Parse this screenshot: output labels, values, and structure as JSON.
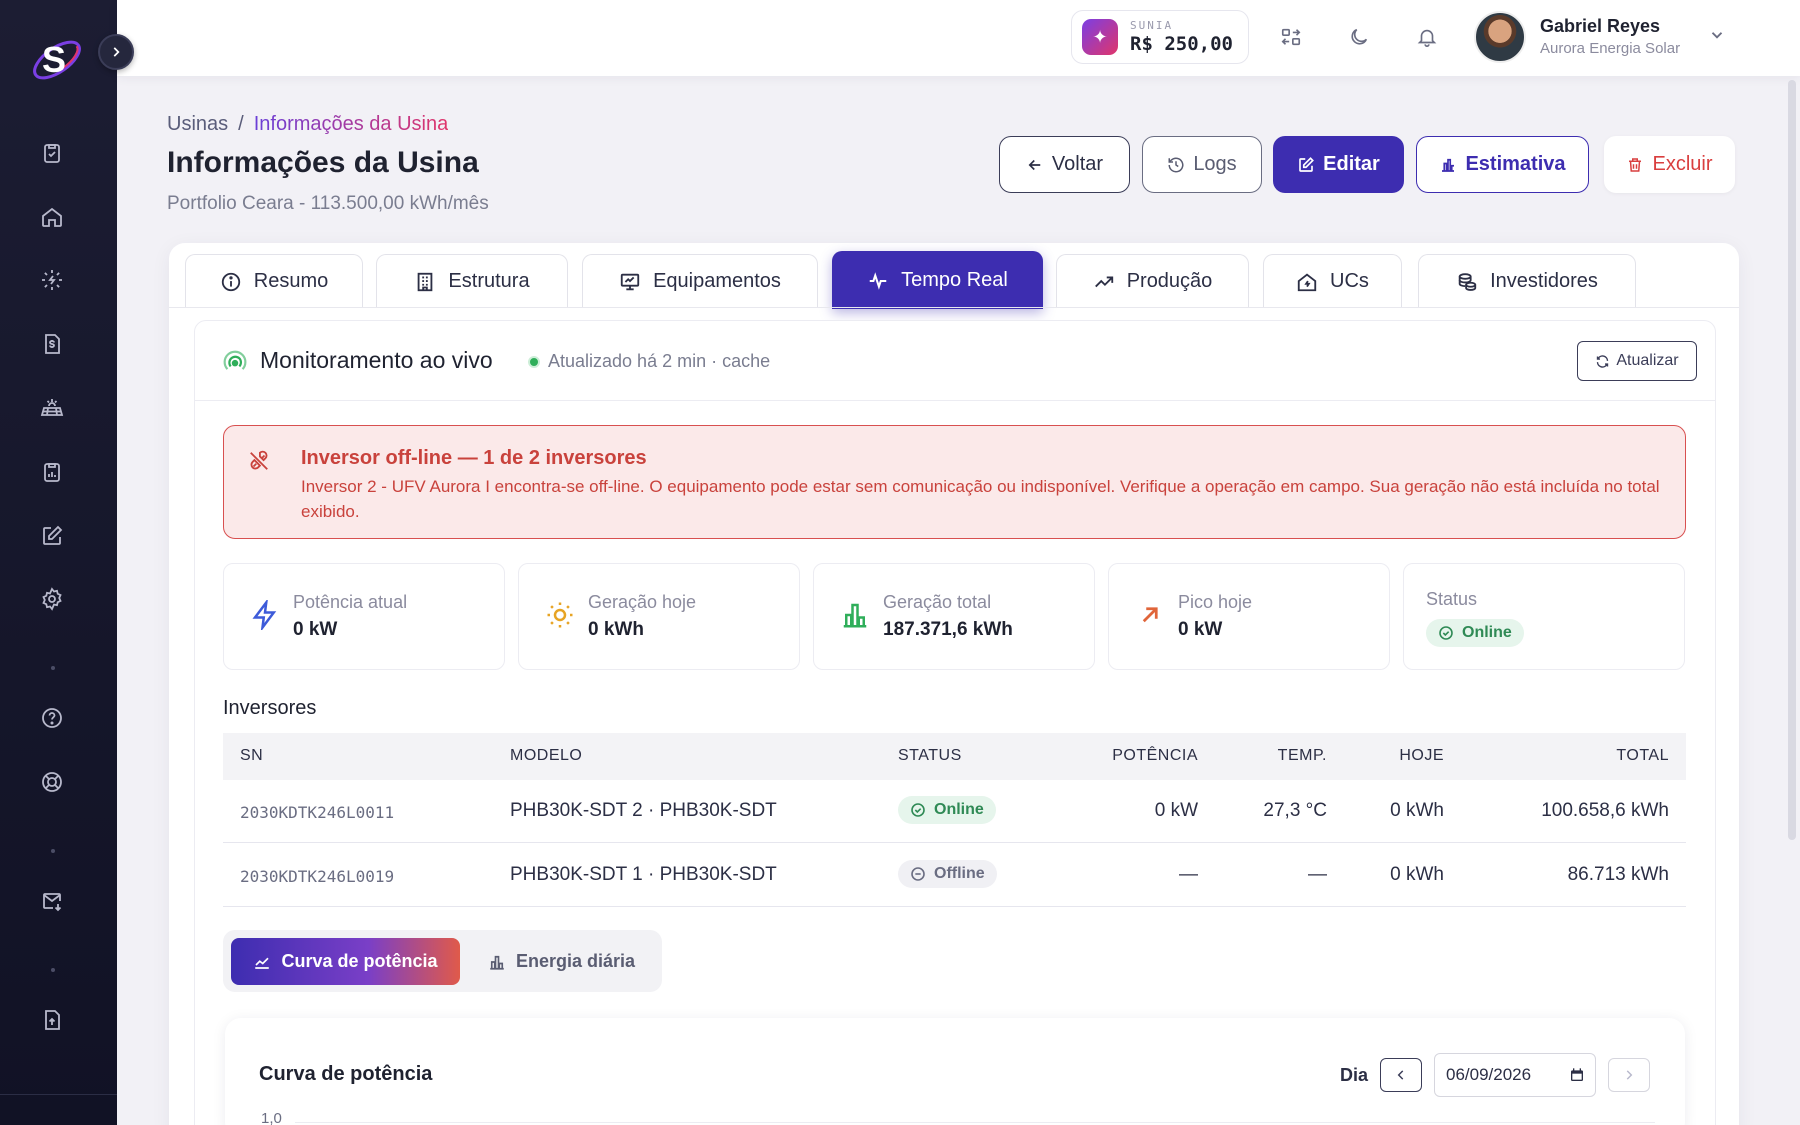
{
  "app": {
    "logo_letter": "S",
    "theme": {
      "accent": "#3d2db0",
      "sidebar_bg": "#1c1d33",
      "danger": "#d93f3f",
      "success": "#2fae5a"
    }
  },
  "sidebar": {
    "items": [
      {
        "icon": "clipboard-check-icon"
      },
      {
        "icon": "home-icon"
      },
      {
        "icon": "sun-bolt-icon"
      },
      {
        "icon": "invoice-dollar-icon"
      },
      {
        "icon": "solar-panel-icon"
      },
      {
        "icon": "clipboard-report-icon"
      },
      {
        "icon": "edit-icon"
      },
      {
        "icon": "gear-icon"
      },
      {
        "icon": "help-circle-icon"
      },
      {
        "icon": "lifebuoy-icon"
      },
      {
        "icon": "mail-download-icon"
      },
      {
        "icon": "file-upload-icon"
      }
    ]
  },
  "topbar": {
    "wallet": {
      "label": "SUNIA",
      "value": "R$ 250,00"
    },
    "user": {
      "name": "Gabriel Reyes",
      "company": "Aurora Energia Solar"
    }
  },
  "page": {
    "breadcrumb": {
      "root": "Usinas",
      "separator": "/",
      "current": "Informações da Usina"
    },
    "title": "Informações da Usina",
    "subtitle": "Portfolio Ceara - 113.500,00 kWh/mês",
    "actions": {
      "back": "Voltar",
      "logs": "Logs",
      "edit": "Editar",
      "estimate": "Estimativa",
      "delete": "Excluir"
    }
  },
  "tabs": [
    {
      "label": "Resumo",
      "icon": "info-icon"
    },
    {
      "label": "Estrutura",
      "icon": "building-icon"
    },
    {
      "label": "Equipamentos",
      "icon": "monitor-icon"
    },
    {
      "label": "Tempo Real",
      "icon": "pulse-icon",
      "active": true
    },
    {
      "label": "Produção",
      "icon": "trending-up-icon"
    },
    {
      "label": "UCs",
      "icon": "home-bolt-icon"
    },
    {
      "label": "Investidores",
      "icon": "coins-icon"
    }
  ],
  "live": {
    "title": "Monitoramento ao vivo",
    "status": "Atualizado há 2 min · cache",
    "refresh_label": "Atualizar"
  },
  "alert": {
    "title": "Inversor off-line — 1 de 2 inversores",
    "body": "Inversor 2 - UFV Aurora I encontra-se off-line. O equipamento pode estar sem comunicação ou indisponível. Verifique a operação em campo. Sua geração não está incluída no total exibido."
  },
  "stats": {
    "power": {
      "label": "Potência atual",
      "value": "0 kW"
    },
    "today": {
      "label": "Geração hoje",
      "value": "0 kWh"
    },
    "total": {
      "label": "Geração total",
      "value": "187.371,6 kWh"
    },
    "peak": {
      "label": "Pico hoje",
      "value": "0 kW"
    },
    "status": {
      "label": "Status",
      "value": "Online"
    }
  },
  "inverters": {
    "title": "Inversores",
    "columns": {
      "sn": "SN",
      "model": "MODELO",
      "status": "STATUS",
      "power": "POTÊNCIA",
      "temp": "TEMP.",
      "today": "HOJE",
      "total": "TOTAL"
    },
    "rows": [
      {
        "sn": "2030KDTK246L0011",
        "model": "PHB30K-SDT 2 · PHB30K-SDT",
        "status": "Online",
        "power": "0 kW",
        "temp": "27,3 °C",
        "today": "0 kWh",
        "total": "100.658,6 kWh"
      },
      {
        "sn": "2030KDTK246L0019",
        "model": "PHB30K-SDT 1 · PHB30K-SDT",
        "status": "Offline",
        "power": "—",
        "temp": "—",
        "today": "0 kWh",
        "total": "86.713 kWh"
      }
    ]
  },
  "chart_toggle": {
    "power_curve": "Curva de potência",
    "daily_energy": "Energia diária"
  },
  "chart": {
    "title": "Curva de potência",
    "day_label": "Dia",
    "date": "06/09/2026",
    "first_ytick": "1,0"
  }
}
